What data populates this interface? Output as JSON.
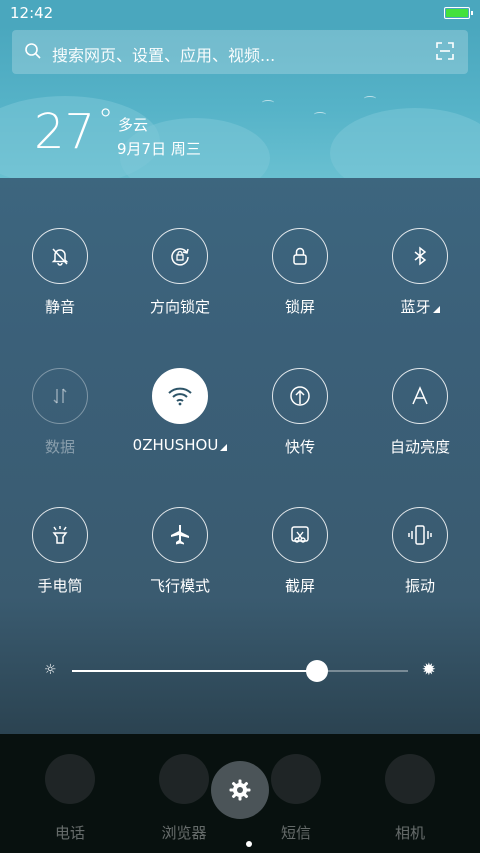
{
  "status_bar": {
    "time": "12:42",
    "battery_color": "#44e13c"
  },
  "search": {
    "placeholder": "搜索网页、设置、应用、视频..."
  },
  "weather": {
    "temperature": "27",
    "degree": "°",
    "condition": "多云",
    "date": "9月7日 周三"
  },
  "toggles": [
    {
      "label": "静音",
      "icon": "bell-off-icon",
      "state": "off"
    },
    {
      "label": "方向锁定",
      "icon": "rotation-lock-icon",
      "state": "off"
    },
    {
      "label": "锁屏",
      "icon": "lock-icon",
      "state": "off"
    },
    {
      "label": "蓝牙",
      "icon": "bluetooth-icon",
      "state": "off",
      "expandable": true
    },
    {
      "label": "数据",
      "icon": "data-transfer-icon",
      "state": "disabled"
    },
    {
      "label": "0ZHUSHOU",
      "icon": "wifi-icon",
      "state": "on",
      "expandable": true
    },
    {
      "label": "快传",
      "icon": "upload-icon",
      "state": "off"
    },
    {
      "label": "自动亮度",
      "icon": "auto-brightness-icon",
      "state": "off"
    },
    {
      "label": "手电筒",
      "icon": "flashlight-icon",
      "state": "off"
    },
    {
      "label": "飞行模式",
      "icon": "airplane-icon",
      "state": "off"
    },
    {
      "label": "截屏",
      "icon": "screenshot-icon",
      "state": "off"
    },
    {
      "label": "振动",
      "icon": "vibrate-icon",
      "state": "off"
    }
  ],
  "brightness": {
    "value": 0.73,
    "icon_low": "☼",
    "icon_high": "✹"
  },
  "dock": [
    {
      "label": "电话"
    },
    {
      "label": "浏览器"
    },
    {
      "label": "短信"
    },
    {
      "label": "相机"
    }
  ],
  "settings_button": {
    "icon": "gear-icon"
  }
}
